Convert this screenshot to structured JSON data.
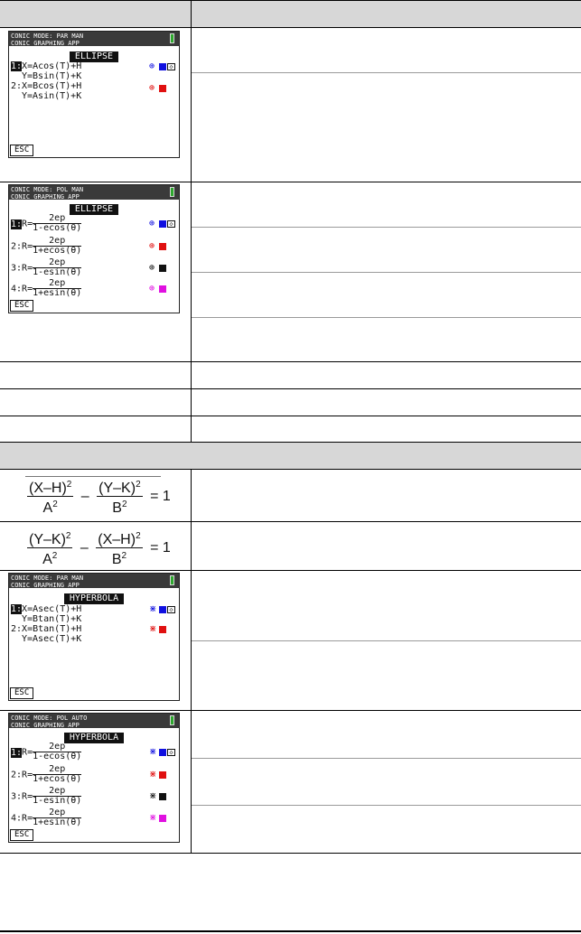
{
  "ellipse": {
    "par": {
      "header_line1": "CONIC MODE: PAR MAN",
      "header_line2": "CONIC GRAPHING APP",
      "mode_title": "ELLIPSE",
      "eq1_index": "1:",
      "eq1_x": "X=Acos(T)+H",
      "eq1_y": "Y=Bsin(T)+K",
      "eq2_index": "2:",
      "eq2_x": "X=Bcos(T)+H",
      "eq2_y": "Y=Asin(T)+K",
      "esc_label": "ESC"
    },
    "pol": {
      "header_line1": "CONIC MODE: POL MAN",
      "header_line2": "CONIC GRAPHING APP",
      "mode_title": "ELLIPSE",
      "rows": [
        {
          "index": "1:",
          "r": "R=",
          "num": "2ep",
          "den": "1-ecos(θ)"
        },
        {
          "index": "2:",
          "r": "R=",
          "num": "2ep",
          "den": "1+ecos(θ)"
        },
        {
          "index": "3:",
          "r": "R=",
          "num": "2ep",
          "den": "1-esin(θ)"
        },
        {
          "index": "4:",
          "r": "R=",
          "num": "2ep",
          "den": "1+esin(θ)"
        }
      ],
      "esc_label": "ESC"
    }
  },
  "hyperbola": {
    "formula1": {
      "n1": "(X–H)",
      "d1": "A",
      "n2": "(Y–K)",
      "d2": "B",
      "exp": "2",
      "minus": "–",
      "eq": "= 1"
    },
    "formula2": {
      "n1": "(Y–K)",
      "d1": "A",
      "n2": "(X–H)",
      "d2": "B",
      "exp": "2",
      "minus": "–",
      "eq": "= 1"
    },
    "par": {
      "header_line1": "CONIC MODE: PAR MAN",
      "header_line2": "CONIC GRAPHING APP",
      "mode_title": "HYPERBOLA",
      "eq1_index": "1:",
      "eq1_x": "X=Asec(T)+H",
      "eq1_y": "Y=Btan(T)+K",
      "eq2_index": "2:",
      "eq2_x": "X=Btan(T)+H",
      "eq2_y": "Y=Asec(T)+K",
      "esc_label": "ESC"
    },
    "pol": {
      "header_line1": "CONIC MODE: POL AUTO",
      "header_line2": "CONIC GRAPHING APP",
      "mode_title": "HYPERBOLA",
      "rows": [
        {
          "index": "1:",
          "r": "R=",
          "num": "2ep",
          "den": "1-ecos(θ)"
        },
        {
          "index": "2:",
          "r": "R=",
          "num": "2ep",
          "den": "1+ecos(θ)"
        },
        {
          "index": "3:",
          "r": "R=",
          "num": "2ep",
          "den": "1-esin(θ)"
        },
        {
          "index": "4:",
          "r": "R=",
          "num": "2ep",
          "den": "1+esin(θ)"
        }
      ],
      "esc_label": "ESC"
    }
  },
  "colors": {
    "header_band": "#d7d7d7",
    "line_blue": "#1010e0",
    "line_red": "#e01010",
    "line_black": "#111111",
    "line_magenta": "#e010e0"
  }
}
